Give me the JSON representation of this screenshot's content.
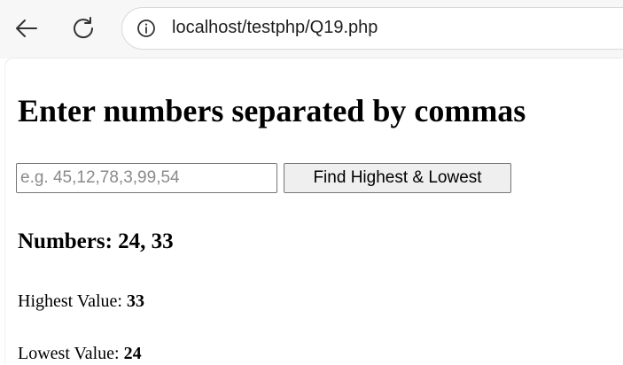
{
  "browser": {
    "url": "localhost/testphp/Q19.php",
    "icons": {
      "back": "arrow-left-icon",
      "reload": "reload-icon",
      "site_info": "info-circle-icon"
    }
  },
  "page": {
    "title": "Enter numbers separated by commas",
    "input": {
      "value": "",
      "placeholder": "e.g. 45,12,78,3,99,54"
    },
    "button_label": "Find Highest & Lowest",
    "numbers_heading": "Numbers: 24, 33",
    "highest": {
      "label": "Highest Value:",
      "value": "33"
    },
    "lowest": {
      "label": "Lowest Value:",
      "value": "24"
    }
  }
}
